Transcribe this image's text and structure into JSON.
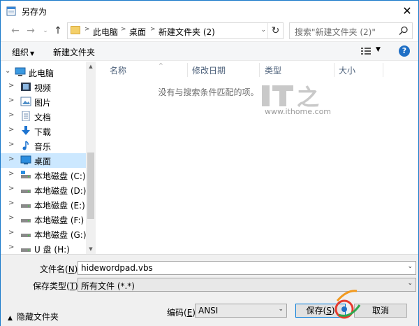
{
  "window": {
    "title": "另存为",
    "close_glyph": "✕"
  },
  "addressbar": {
    "path": [
      "此电脑",
      "桌面",
      "新建文件夹 (2)"
    ],
    "search_placeholder": "搜索\"新建文件夹 (2)\""
  },
  "toolbar": {
    "organize": "组织",
    "new_folder": "新建文件夹",
    "help": "?"
  },
  "navpane": {
    "items": [
      {
        "label": "此电脑",
        "icon": "computer-icon"
      },
      {
        "label": "视频",
        "icon": "video-icon"
      },
      {
        "label": "图片",
        "icon": "pictures-icon"
      },
      {
        "label": "文档",
        "icon": "documents-icon"
      },
      {
        "label": "下载",
        "icon": "download-icon"
      },
      {
        "label": "音乐",
        "icon": "music-icon"
      },
      {
        "label": "桌面",
        "icon": "desktop-icon"
      },
      {
        "label": "本地磁盘 (C:)",
        "icon": "drive-icon"
      },
      {
        "label": "本地磁盘 (D:)",
        "icon": "drive-icon"
      },
      {
        "label": "本地磁盘 (E:)",
        "icon": "drive-icon"
      },
      {
        "label": "本地磁盘 (F:)",
        "icon": "drive-icon"
      },
      {
        "label": "本地磁盘 (G:)",
        "icon": "drive-icon"
      },
      {
        "label": "U 盘 (H:)",
        "icon": "usb-drive-icon"
      }
    ]
  },
  "filelist": {
    "columns": [
      "名称",
      "修改日期",
      "类型",
      "大小"
    ],
    "empty_message": "没有与搜索条件匹配的项。"
  },
  "watermark": {
    "brand": "IT之家",
    "url": "www.ithome.com"
  },
  "form": {
    "filename_label": "文件名(",
    "filename_key": "N",
    "filename_suffix": "):",
    "filename_value": "hidewordpad.vbs",
    "filetype_label": "保存类型(",
    "filetype_key": "T",
    "filetype_suffix": "):",
    "filetype_value": "所有文件 (*.*)",
    "encoding_label": "编码(",
    "encoding_key": "E",
    "encoding_suffix": "):",
    "encoding_value": "ANSI",
    "save_label": "保存(",
    "save_key": "S",
    "save_suffix": ")",
    "cancel_label": "取消",
    "hide_folders": "隐藏文件夹"
  },
  "colors": {
    "accent": "#0078d7",
    "selected": "#cce8ff"
  }
}
